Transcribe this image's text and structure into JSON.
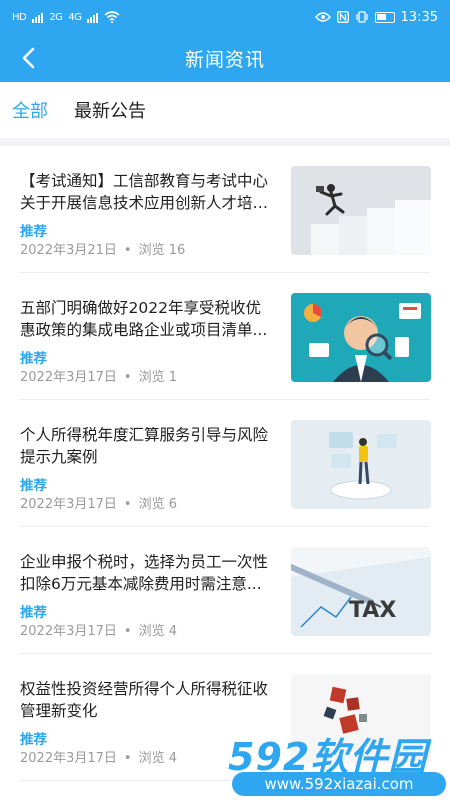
{
  "status_bar": {
    "network_left": "HD",
    "network_mid": "2G",
    "network_right": "4G",
    "time": "13:35",
    "icons": [
      "hd-icon",
      "signal-icon",
      "wifi-icon",
      "eye-icon",
      "nfc-icon",
      "vibrate-icon",
      "battery-icon"
    ]
  },
  "nav": {
    "title": "新闻资讯",
    "back_icon": "chevron-left-icon"
  },
  "tabs": [
    {
      "label": "全部",
      "active": true
    },
    {
      "label": "最新公告",
      "active": false
    }
  ],
  "colors": {
    "accent": "#2ea7f0",
    "text": "#1f1f1f",
    "meta": "#9a9a9a",
    "divider": "#ececec"
  },
  "news": [
    {
      "title": "【考试通知】工信部教育与考试中心关于开展信息技术应用创新人才培养...",
      "tag": "推荐",
      "date": "2022年3月21日",
      "views": "浏览 16",
      "thumb": "running-businessman-on-steps"
    },
    {
      "title": "五部门明确做好2022年享受税收优惠政策的集成电路企业或项目清单...",
      "tag": "推荐",
      "date": "2022年3月17日",
      "views": "浏览 1",
      "thumb": "businessman-with-magnifier"
    },
    {
      "title": "个人所得税年度汇算服务引导与风险提示九案例",
      "tag": "推荐",
      "date": "2022年3月17日",
      "views": "浏览 6",
      "thumb": "person-with-hologram-screens"
    },
    {
      "title": "企业申报个税时，选择为员工一次性扣除6万元基本减除费用时需注意...",
      "tag": "推荐",
      "date": "2022年3月17日",
      "views": "浏览 4",
      "thumb": "tax-document-with-pen"
    },
    {
      "title": "权益性投资经营所得个人所得税征收管理新变化",
      "tag": "推荐",
      "date": "2022年3月17日",
      "views": "浏览 4",
      "thumb": "tax-characters"
    }
  ],
  "watermark": {
    "logo": "592软件园",
    "url": "www.592xiazai.com"
  }
}
